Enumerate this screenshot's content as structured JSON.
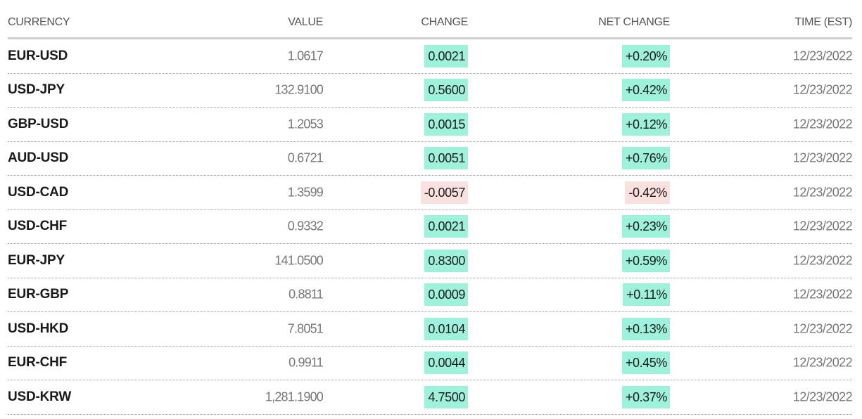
{
  "table": {
    "columns": {
      "currency": "CURRENCY",
      "value": "VALUE",
      "change": "CHANGE",
      "net_change": "NET CHANGE",
      "time": "TIME (EST)"
    },
    "colors": {
      "up": "#9ef2dc",
      "down": "#fbe0e0"
    },
    "rows": [
      {
        "currency": "EUR-USD",
        "value": "1.0617",
        "change": "0.0021",
        "net_change": "+0.20%",
        "time": "12/23/2022",
        "direction": "up"
      },
      {
        "currency": "USD-JPY",
        "value": "132.9100",
        "change": "0.5600",
        "net_change": "+0.42%",
        "time": "12/23/2022",
        "direction": "up"
      },
      {
        "currency": "GBP-USD",
        "value": "1.2053",
        "change": "0.0015",
        "net_change": "+0.12%",
        "time": "12/23/2022",
        "direction": "up"
      },
      {
        "currency": "AUD-USD",
        "value": "0.6721",
        "change": "0.0051",
        "net_change": "+0.76%",
        "time": "12/23/2022",
        "direction": "up"
      },
      {
        "currency": "USD-CAD",
        "value": "1.3599",
        "change": "-0.0057",
        "net_change": "-0.42%",
        "time": "12/23/2022",
        "direction": "down"
      },
      {
        "currency": "USD-CHF",
        "value": "0.9332",
        "change": "0.0021",
        "net_change": "+0.23%",
        "time": "12/23/2022",
        "direction": "up"
      },
      {
        "currency": "EUR-JPY",
        "value": "141.0500",
        "change": "0.8300",
        "net_change": "+0.59%",
        "time": "12/23/2022",
        "direction": "up"
      },
      {
        "currency": "EUR-GBP",
        "value": "0.8811",
        "change": "0.0009",
        "net_change": "+0.11%",
        "time": "12/23/2022",
        "direction": "up"
      },
      {
        "currency": "USD-HKD",
        "value": "7.8051",
        "change": "0.0104",
        "net_change": "+0.13%",
        "time": "12/23/2022",
        "direction": "up"
      },
      {
        "currency": "EUR-CHF",
        "value": "0.9911",
        "change": "0.0044",
        "net_change": "+0.45%",
        "time": "12/23/2022",
        "direction": "up"
      },
      {
        "currency": "USD-KRW",
        "value": "1,281.1900",
        "change": "4.7500",
        "net_change": "+0.37%",
        "time": "12/23/2022",
        "direction": "up"
      }
    ]
  }
}
